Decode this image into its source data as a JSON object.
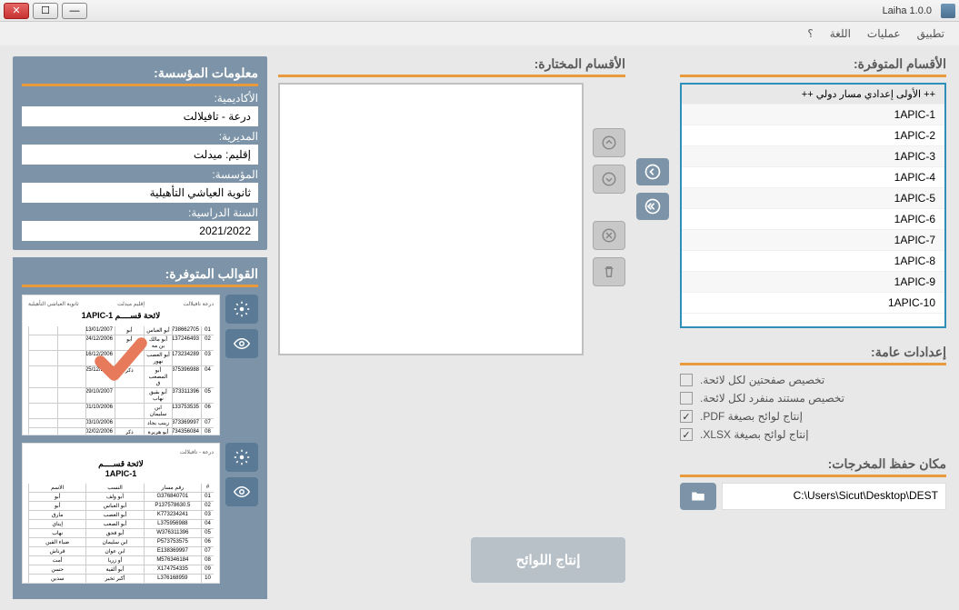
{
  "window": {
    "title": "Laiha 1.0.0"
  },
  "menu": {
    "app": "تطبيق",
    "ops": "عمليات",
    "lang": "اللغة",
    "help": "؟"
  },
  "sections": {
    "available": "الأقسام المتوفرة:",
    "selected": "الأقسام المختارة:",
    "settings": "إعدادات عامة:",
    "output": "مكان حفظ المخرجات:",
    "info": "معلومات المؤسسة:",
    "templates": "القوالب المتوفرة:"
  },
  "available_items": [
    "++ الأولى إعدادي مسار دولي ++",
    "1APIC-1",
    "1APIC-2",
    "1APIC-3",
    "1APIC-4",
    "1APIC-5",
    "1APIC-6",
    "1APIC-7",
    "1APIC-8",
    "1APIC-9",
    "1APIC-10"
  ],
  "settings": {
    "two_pages": {
      "label": "تخصيص صفحتين لكل لائحة.",
      "checked": false
    },
    "sep_doc": {
      "label": "تخصيص مستند منفرد لكل لائحة.",
      "checked": false
    },
    "pdf": {
      "label": "إنتاج لوائح بصيغة PDF.",
      "checked": true
    },
    "xlsx": {
      "label": "إنتاج لوائح بصيغة XLSX.",
      "checked": true
    }
  },
  "output_path": "C:\\Users\\Sicut\\Desktop\\DEST",
  "generate_label": "إنتاج اللوائح",
  "info": {
    "academy_label": "الأكاديمية:",
    "academy_value": "درعة - تافيلالت",
    "direction_label": "المديرية:",
    "direction_value": "إقليم: ميدلت",
    "school_label": "المؤسسة:",
    "school_value": "ثانوية العياشي التأهيلية",
    "year_label": "السنة الدراسية:",
    "year_value": "2021/2022"
  },
  "templates": {
    "t1_title": "لائحة قســــم 1APIC-1",
    "t2_title": "لائحة قســــم",
    "t2_sub": "1APIC-1"
  }
}
